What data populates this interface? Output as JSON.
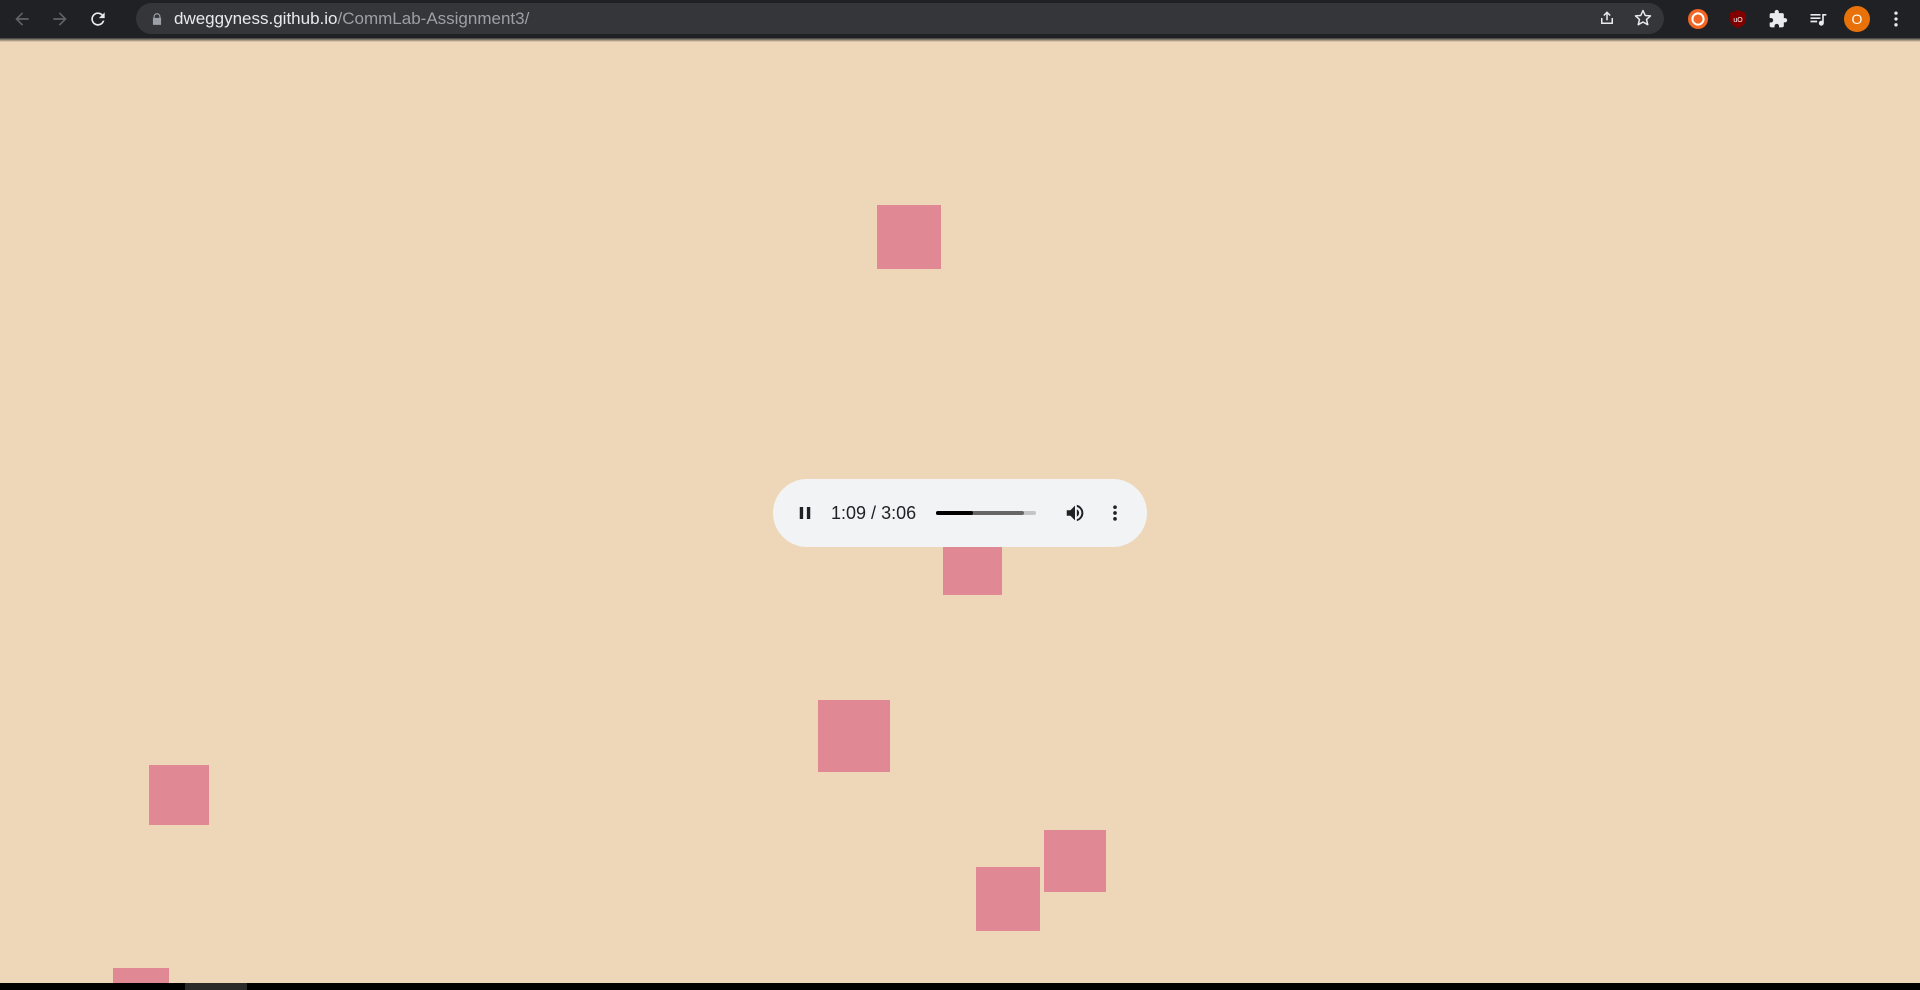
{
  "browser": {
    "url_host": "dweggyness.github.io",
    "url_path": "/CommLab-Assignment3/",
    "profile_initial": "O",
    "icons": {
      "back": "arrow-left-icon",
      "forward": "arrow-right-icon",
      "reload": "reload-icon",
      "lock": "lock-icon",
      "share": "share-icon",
      "bookmark": "star-icon",
      "ext1": "lifebuoy-extension-icon",
      "ext2": "ublock-extension-icon",
      "extensions": "puzzle-icon",
      "media": "media-playlist-icon",
      "menu": "kebab-menu-icon"
    },
    "colors": {
      "toolbar": "#202124",
      "omnibox": "#35363a",
      "profile": "#e8710a"
    }
  },
  "page": {
    "background_color": "#eed7b8",
    "square_color": "#e08893",
    "audio_player": {
      "current_time": "1:09",
      "separator": " / ",
      "duration": "3:06",
      "played_fraction": 0.37,
      "buffered_fraction": 0.88,
      "icons": {
        "play": "pause-icon",
        "volume": "volume-icon",
        "more": "more-vertical-icon"
      }
    }
  }
}
